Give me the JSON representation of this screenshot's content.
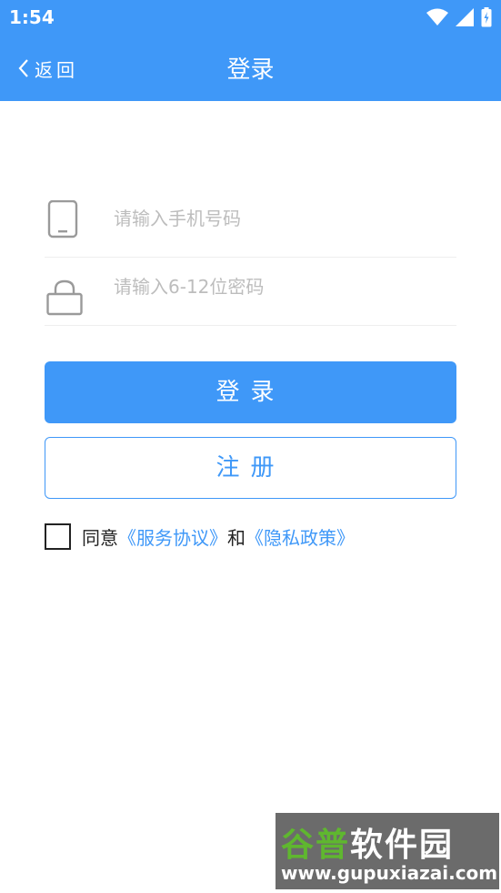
{
  "status_bar": {
    "time": "1:54"
  },
  "app_bar": {
    "back_label": "返回",
    "title": "登录"
  },
  "form": {
    "phone_placeholder": "请输入手机号码",
    "password_placeholder": "请输入6-12位密码"
  },
  "buttons": {
    "login": "登录",
    "register": "注册"
  },
  "agreement": {
    "prefix": "同意",
    "service_link": "《服务协议》",
    "and": "和",
    "privacy_link": "《隐私政策》"
  },
  "watermark": {
    "brand_part1": "谷普",
    "brand_part2": "软件园",
    "url": "www.gupuxiazai.com"
  },
  "colors": {
    "primary": "#3f98f8",
    "watermark_green": "#5fb72f"
  }
}
